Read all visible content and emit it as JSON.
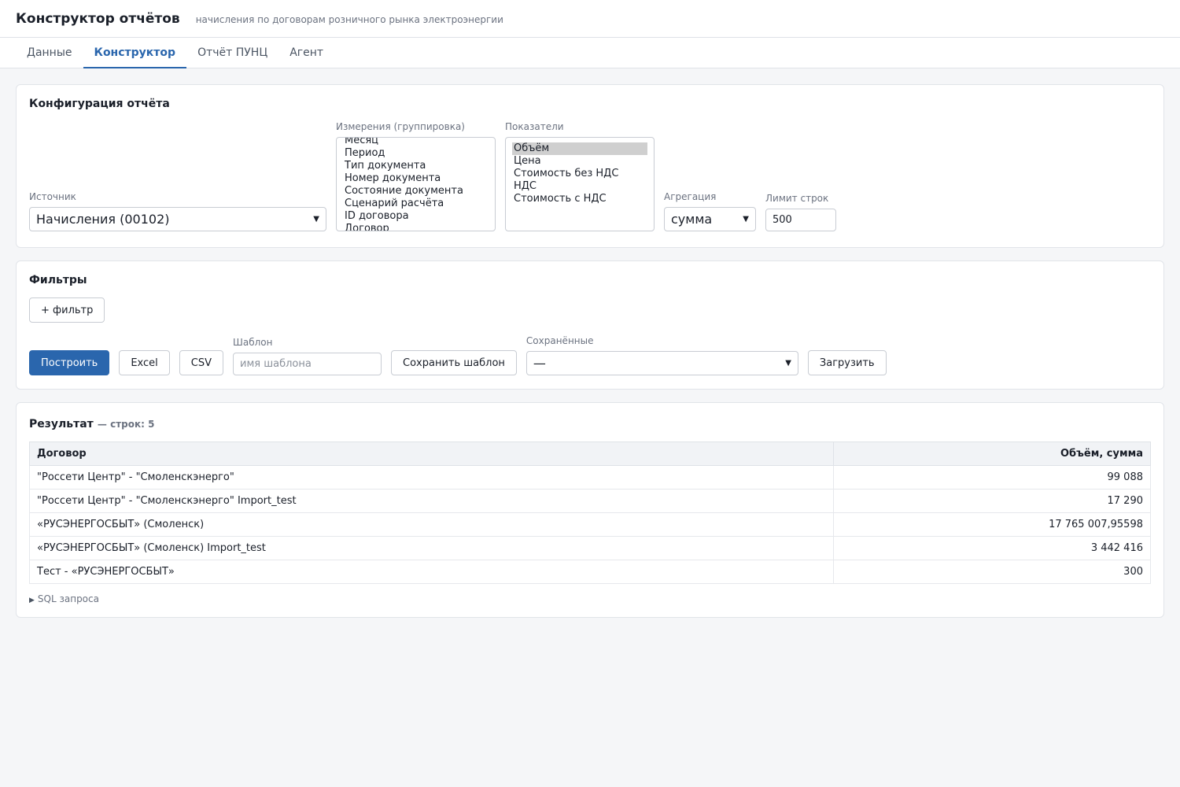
{
  "header": {
    "title": "Конструктор отчётов",
    "subtitle": "начисления по договорам розничного рынка электроэнергии"
  },
  "tabs": [
    {
      "label": "Данные",
      "active": false
    },
    {
      "label": "Конструктор",
      "active": true
    },
    {
      "label": "Отчёт ПУНЦ",
      "active": false
    },
    {
      "label": "Агент",
      "active": false
    }
  ],
  "config": {
    "title": "Конфигурация отчёта",
    "source_label": "Источник",
    "source_value": "Начисления (00102)",
    "dimensions_label": "Измерения (группировка)",
    "dimensions": [
      "Месяц",
      "Период",
      "Тип документа",
      "Номер документа",
      "Состояние документа",
      "Сценарий расчёта",
      "ID договора",
      "Договор"
    ],
    "metrics_label": "Показатели",
    "metrics": [
      "Объём",
      "Цена",
      "Стоимость без НДС",
      "НДС",
      "Стоимость с НДС"
    ],
    "aggregation_label": "Агрегация",
    "aggregation_value": "сумма",
    "limit_label": "Лимит строк",
    "limit_value": "500"
  },
  "filters": {
    "title": "Фильтры",
    "add_filter_label": "+ фильтр",
    "build_label": "Построить",
    "excel_label": "Excel",
    "csv_label": "CSV",
    "template_label": "Шаблон",
    "template_placeholder": "имя шаблона",
    "save_template_label": "Сохранить шаблон",
    "saved_label": "Сохранённые",
    "saved_value": "—",
    "load_label": "Загрузить"
  },
  "result": {
    "title": "Результат",
    "count_text": "— строк: 5",
    "columns": [
      "Договор",
      "Объём, сумма"
    ],
    "rows": [
      [
        "\"Россети Центр\" - \"Смоленскэнерго\"",
        "99 088"
      ],
      [
        "\"Россети Центр\" - \"Смоленскэнерго\" Import_test",
        "17 290"
      ],
      [
        "«РУСЭНЕРГОСБЫТ» (Смоленск)",
        "17 765 007,95598"
      ],
      [
        "«РУСЭНЕРГОСБЫТ» (Смоленск) Import_test",
        "3 442 416"
      ],
      [
        "Тест - «РУСЭНЕРГОСБЫТ»",
        "300"
      ]
    ],
    "sql_toggle_label": "SQL запроса"
  }
}
